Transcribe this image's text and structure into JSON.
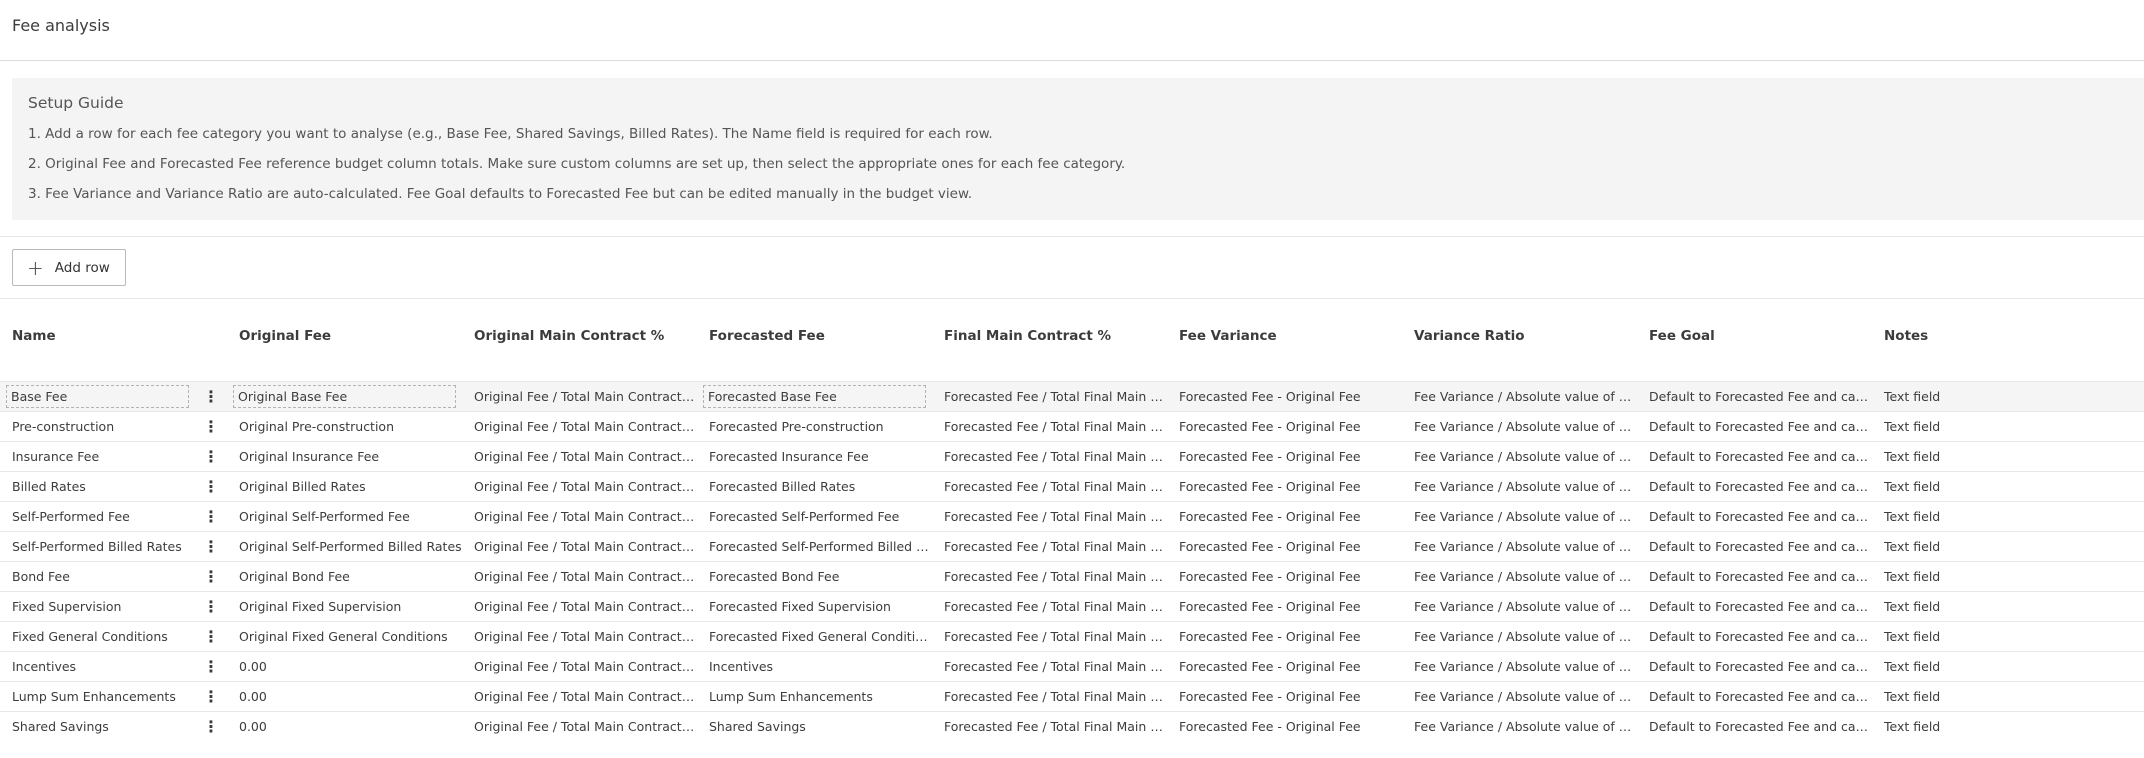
{
  "page": {
    "title": "Fee analysis"
  },
  "guide": {
    "title": "Setup Guide",
    "steps": [
      "1. Add a row for each fee category you want to analyse (e.g., Base Fee, Shared Savings, Billed Rates). The Name field is required for each row.",
      "2. Original Fee and Forecasted Fee reference budget column totals. Make sure custom columns are set up, then select the appropriate ones for each fee category.",
      "3. Fee Variance and Variance Ratio are auto-calculated. Fee Goal defaults to Forecasted Fee but can be edited manually in the budget view."
    ]
  },
  "toolbar": {
    "add_row_label": "Add row"
  },
  "table": {
    "headers": [
      "Name",
      "Original Fee",
      "Original Main Contract %",
      "Forecasted Fee",
      "Final Main Contract %",
      "Fee Variance",
      "Variance Ratio",
      "Fee Goal",
      "Notes"
    ],
    "placeholders": {
      "orig_pct": "Original Fee / Total Main Contract Amount",
      "final_pct": "Forecasted Fee / Total Final Main Contract Amount",
      "variance": "Forecasted Fee - Original Fee",
      "ratio": "Fee Variance / Absolute value of Original Fee",
      "goal": "Default to Forecasted Fee and can be edited",
      "notes": "Text field"
    },
    "menu_glyph": "⋮",
    "rows": [
      {
        "name": "Base Fee",
        "original": "Original Base Fee",
        "forecasted": "Forecasted Base Fee"
      },
      {
        "name": "Pre-construction",
        "original": "Original Pre-construction",
        "forecasted": "Forecasted Pre-construction"
      },
      {
        "name": "Insurance Fee",
        "original": "Original Insurance Fee",
        "forecasted": "Forecasted Insurance Fee"
      },
      {
        "name": "Billed Rates",
        "original": "Original Billed Rates",
        "forecasted": "Forecasted Billed Rates"
      },
      {
        "name": "Self-Performed Fee",
        "original": "Original Self-Performed Fee",
        "forecasted": "Forecasted Self-Performed Fee"
      },
      {
        "name": "Self-Performed Billed Rates",
        "original": "Original Self-Performed Billed Rates",
        "forecasted": "Forecasted Self-Performed Billed Rates"
      },
      {
        "name": "Bond Fee",
        "original": "Original Bond Fee",
        "forecasted": "Forecasted Bond Fee"
      },
      {
        "name": "Fixed Supervision",
        "original": "Original Fixed Supervision",
        "forecasted": "Forecasted Fixed Supervision"
      },
      {
        "name": "Fixed General Conditions",
        "original": "Original Fixed General Conditions",
        "forecasted": "Forecasted Fixed General Conditions"
      },
      {
        "name": "Incentives",
        "original": "0.00",
        "forecasted": "Incentives"
      },
      {
        "name": "Lump Sum Enhancements",
        "original": "0.00",
        "forecasted": "Lump Sum Enhancements"
      },
      {
        "name": "Shared Savings",
        "original": "0.00",
        "forecasted": "Shared Savings"
      }
    ]
  }
}
